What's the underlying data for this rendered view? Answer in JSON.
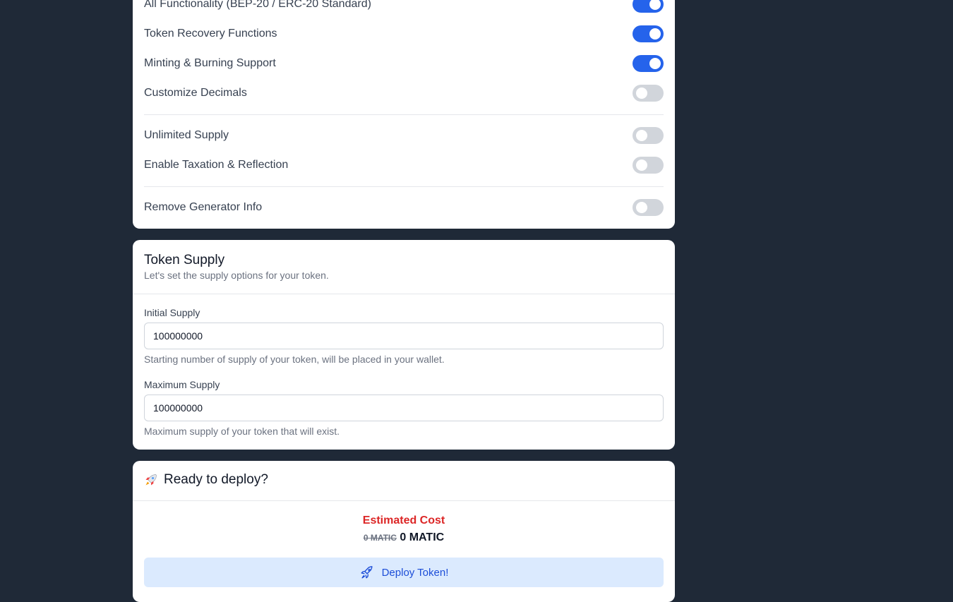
{
  "features": {
    "options": [
      {
        "label": "All Functionality (BEP-20 / ERC-20 Standard)",
        "enabled": true
      },
      {
        "label": "Token Recovery Functions",
        "enabled": true
      },
      {
        "label": "Minting & Burning Support",
        "enabled": true
      },
      {
        "label": "Customize Decimals",
        "enabled": false
      },
      {
        "label": "Unlimited Supply",
        "enabled": false
      },
      {
        "label": "Enable Taxation & Reflection",
        "enabled": false
      },
      {
        "label": "Remove Generator Info",
        "enabled": false
      }
    ]
  },
  "supply": {
    "title": "Token Supply",
    "subtitle": "Let's set the supply options for your token.",
    "initial": {
      "label": "Initial Supply",
      "value": "100000000",
      "help": "Starting number of supply of your token, will be placed in your wallet."
    },
    "maximum": {
      "label": "Maximum Supply",
      "value": "100000000",
      "help": "Maximum supply of your token that will exist."
    }
  },
  "deploy": {
    "title": "Ready to deploy?",
    "title_icon": "rocket-icon",
    "cost_label": "Estimated Cost",
    "cost_old": "0 MATIC",
    "cost_new": "0 MATIC",
    "button_label": "Deploy Token!",
    "button_icon": "rocket-icon"
  },
  "colors": {
    "background": "#1f2937",
    "toggle_on": "#2563eb",
    "toggle_off": "#d1d5db",
    "cost_label": "#dc2626",
    "deploy_button_bg": "#dbeafe",
    "deploy_button_text": "#1d4ed8"
  }
}
